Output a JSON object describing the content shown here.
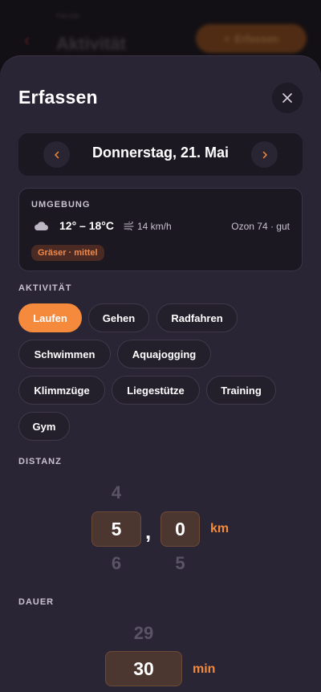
{
  "background": {
    "subtitle": "Heute",
    "title": "Aktivität",
    "action_label": "Erfassen"
  },
  "sheet": {
    "title": "Erfassen",
    "date": "Donnerstag, 21. Mai",
    "environment": {
      "heading": "UMGEBUNG",
      "temperature": "12° – 18°C",
      "wind": "14 km/h",
      "ozone": "Ozon 74 · gut",
      "pollen": "Gräser · mittel"
    },
    "activity": {
      "label": "AKTIVITÄT",
      "options": [
        "Laufen",
        "Gehen",
        "Radfahren",
        "Schwimmen",
        "Aquajogging",
        "Klimmzüge",
        "Liegestütze",
        "Training",
        "Gym"
      ],
      "selected": "Laufen"
    },
    "distance": {
      "label": "DISTANZ",
      "int_prev": "4",
      "int_value": "5",
      "int_next": "6",
      "separator": ",",
      "dec_value": "0",
      "dec_next": "5",
      "unit": "km"
    },
    "duration": {
      "label": "DAUER",
      "prev": "29",
      "value": "30",
      "unit": "min"
    }
  },
  "colors": {
    "accent": "#f58a3c",
    "sheet_bg": "#2a2535",
    "card_bg": "#1b1822"
  }
}
